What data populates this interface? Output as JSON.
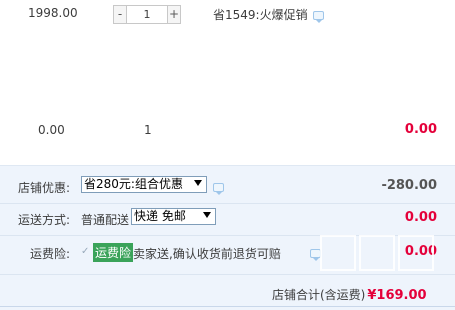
{
  "item1": {
    "price": "1998.00",
    "qty_minus": "-",
    "qty_value": "1",
    "qty_plus": "+",
    "promo_text": "省1549:火爆促销",
    "promo_chat_icon": "chat-bubble-icon"
  },
  "item2": {
    "price": "0.00",
    "qty": "1",
    "total": "0.00"
  },
  "store_discount": {
    "label": "店铺优惠:",
    "selected": "省280元:组合优惠",
    "chat_icon": "chat-bubble-icon",
    "value": "-280.00"
  },
  "shipping": {
    "label": "运送方式:",
    "method": "普通配送",
    "selected": "快递 免邮",
    "value": "0.00"
  },
  "shipping_insurance": {
    "label": "运费险:",
    "checked_mark": "✓",
    "tag": "运费险",
    "description": "卖家送,确认收货前退货可赔",
    "chat_icon": "chat-bubble-icon",
    "value": "0.00"
  },
  "store_total": {
    "label": "店铺合计(含运费)",
    "amount": "¥169.00"
  },
  "colors": {
    "price_red": "#e4003a",
    "panel_bg": "#eef4fc",
    "insurance_tag_green": "#3aa35a"
  }
}
